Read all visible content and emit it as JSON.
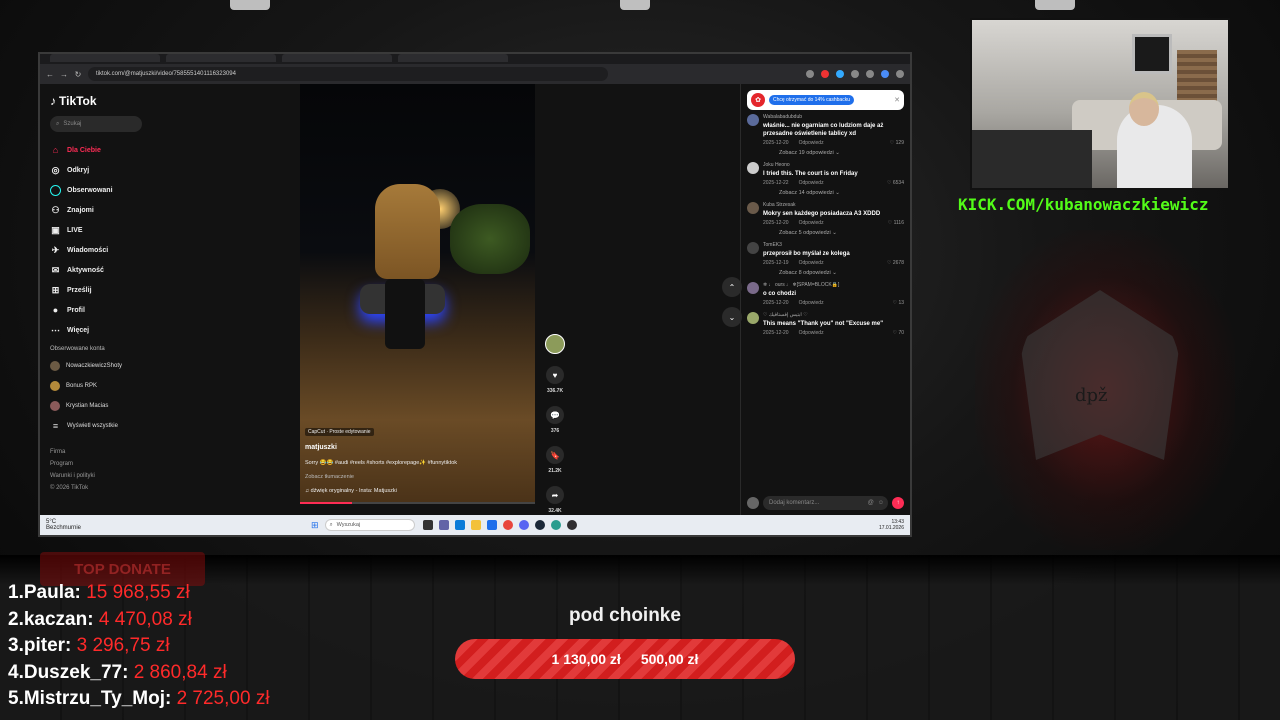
{
  "browser": {
    "url": "tiktok.com/@matjuszki/video/7585551401116323094"
  },
  "tiktok": {
    "logo": "TikTok",
    "search_placeholder": "Szukaj",
    "menu": [
      {
        "label": "Dla Ciebie",
        "icon": "home-icon"
      },
      {
        "label": "Odkryj",
        "icon": "compass-icon"
      },
      {
        "label": "Obserwowani",
        "icon": "following-icon"
      },
      {
        "label": "Znajomi",
        "icon": "friends-icon"
      },
      {
        "label": "LIVE",
        "icon": "live-icon"
      },
      {
        "label": "Wiadomości",
        "icon": "messages-icon"
      },
      {
        "label": "Aktywność",
        "icon": "activity-icon"
      },
      {
        "label": "Prześlij",
        "icon": "upload-icon"
      },
      {
        "label": "Profil",
        "icon": "profile-icon"
      },
      {
        "label": "Więcej",
        "icon": "more-icon"
      }
    ],
    "following_title": "Obserwowane konta",
    "following": [
      "NowaczkiewiczShoty",
      "Bonus RPK",
      "Krystian Macias",
      "Wyświetl wszystkie"
    ],
    "footer": [
      "Firma",
      "Program",
      "Warunki i polityki",
      "© 2026 TikTok"
    ],
    "video": {
      "capcut": "CapCut · Proste edytowanie",
      "author": "matjuszki",
      "description": "Sorry 😂😂 #audi #reels #shorts #explorepage✨ #funnytiktok",
      "translate": "Zobacz tłumaczenie",
      "sound": "♫  dźwięk oryginalny - Insta: Matjuszki",
      "progress": 0.22
    },
    "actions": {
      "likes": "336.7K",
      "comments": "376",
      "saves": "21.2K",
      "shares": "32.4K"
    },
    "promo": "Chcę otrzymać do 14% cashbacku",
    "comments": [
      {
        "user": "Wabalabadubdub",
        "text": "właśnie... nie ogarniam co ludziom daje aż przesadne oświetlenie tablicy xd",
        "date": "2025-12-20",
        "reply": "Odpowiedz",
        "likes": "129",
        "replies": "Zobacz 19 odpowiedzi ⌄"
      },
      {
        "user": "Joku Heono",
        "text": "I tried this. The court is on Friday",
        "date": "2025-12-22",
        "reply": "Odpowiedz",
        "likes": "6534",
        "replies": "Zobacz 14 odpowiedzi ⌄"
      },
      {
        "user": "Kuba Strzesak",
        "text": "Mokry sen każdego posiadacza A3 XDDD",
        "date": "2025-12-20",
        "reply": "Odpowiedz",
        "likes": "1116",
        "replies": "Zobacz 5 odpowiedzi ⌄"
      },
      {
        "user": "TomEK3",
        "text": "przeprosił bo myślał ze kolega",
        "date": "2025-12-19",
        "reply": "Odpowiedz",
        "likes": "2678",
        "replies": "Zobacz 8 odpowiedzi ⌄"
      },
      {
        "user": "❄ ♩ ours ♩ ❄[SPAM=BLOCK🔒]",
        "text": "o co chodzi",
        "date": "2025-12-20",
        "reply": "Odpowiedz",
        "likes": "13",
        "replies": ""
      },
      {
        "user": "♡ ابتيس إفستافيك ♡",
        "text": "This means \"Thank you\" not \"Excuse me\"",
        "date": "2025-12-20",
        "reply": "Odpowiedz",
        "likes": "70",
        "replies": ""
      }
    ],
    "comment_placeholder": "Dodaj komentarz..."
  },
  "taskbar": {
    "weather_temp": "5°C",
    "weather_desc": "Bezchmurnie",
    "search": "Wyszukaj",
    "time": "13:43",
    "date": "17.01.2026"
  },
  "stream": {
    "kick": "KICK.COM/kubanowaczkiewicz",
    "emblem_text": "dpž",
    "top_donate": "TOP DONATE",
    "donors": [
      {
        "rank": "1.",
        "name": "Paula:",
        "amount": "15 968,55 zł"
      },
      {
        "rank": "2.",
        "name": "kaczan:",
        "amount": "4 470,08 zł"
      },
      {
        "rank": "3.",
        "name": "piter:",
        "amount": "3 296,75 zł"
      },
      {
        "rank": "4.",
        "name": "Duszek_77:",
        "amount": "2 860,84 zł"
      },
      {
        "rank": "5.",
        "name": "Mistrzu_Ty_Moj:",
        "amount": "2 725,00 zł"
      }
    ],
    "goal_title": "pod choinke",
    "goal_current": "1 130,00 zł",
    "goal_target": "500,00 zł"
  }
}
